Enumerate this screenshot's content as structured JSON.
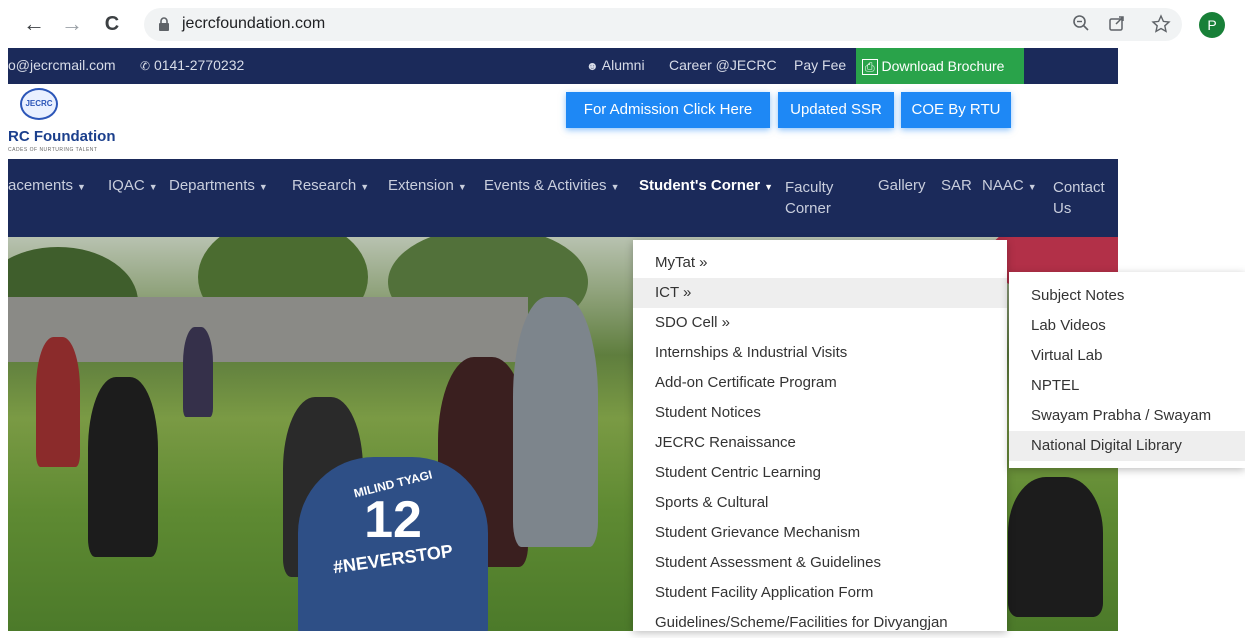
{
  "browser": {
    "url": "jecrcfoundation.com",
    "back_glyph": "←",
    "forward_glyph": "→",
    "reload_glyph": "C",
    "profile_initial": "P",
    "icons": [
      "zoom-icon",
      "share-icon",
      "bookmark-star-icon"
    ]
  },
  "topbar": {
    "email": "o@jecrcmail.com",
    "phone": "0141-2770232",
    "alumni": "Alumni",
    "career": "Career @JECRC",
    "pay_fee": "Pay Fee",
    "brochure": "Download Brochure"
  },
  "logo": {
    "badge_text": "JECRC",
    "name": "RC Foundation",
    "tagline": "CADES OF NURTURING TALENT"
  },
  "header_buttons": {
    "admission": "For Admission Click Here",
    "ssr": "Updated SSR",
    "coe": "COE By RTU"
  },
  "nav": {
    "items": [
      {
        "label": "acements"
      },
      {
        "label": "IQAC"
      },
      {
        "label": "Departments"
      },
      {
        "label": "Research"
      },
      {
        "label": "Extension"
      },
      {
        "label": "Events & Activities"
      },
      {
        "label": "Student's Corner"
      },
      {
        "label_line1": "Faculty",
        "label_line2": "Corner"
      },
      {
        "label": "Gallery"
      },
      {
        "label": "SAR"
      },
      {
        "label": "NAAC"
      },
      {
        "label_line1": "Contact",
        "label_line2": "Us"
      }
    ]
  },
  "dropdown": {
    "items": [
      "MyTat »",
      "ICT »",
      "SDO Cell »",
      "Internships & Industrial Visits",
      "Add-on Certificate Program",
      "Student Notices",
      "JECRC Renaissance",
      "Student Centric Learning",
      "Sports & Cultural",
      "Student Grievance Mechanism",
      "Student Assessment & Guidelines",
      "Student Facility Application Form",
      "Guidelines/Scheme/Facilities for Divyangjan"
    ],
    "highlighted": "ICT »"
  },
  "submenu": {
    "items": [
      "Subject Notes",
      "Lab Videos",
      "Virtual Lab",
      "NPTEL",
      "Swayam Prabha / Swayam",
      "National Digital Library"
    ],
    "highlighted": "National Digital Library"
  },
  "hero": {
    "jersey_name": "MILIND TYAGI",
    "jersey_number": "12",
    "jersey_hashtag": "#NEVERSTOP"
  },
  "colors": {
    "navy": "#1b2a5a",
    "accent_blue": "#1e88f5",
    "brochure_green": "#29a34a"
  }
}
